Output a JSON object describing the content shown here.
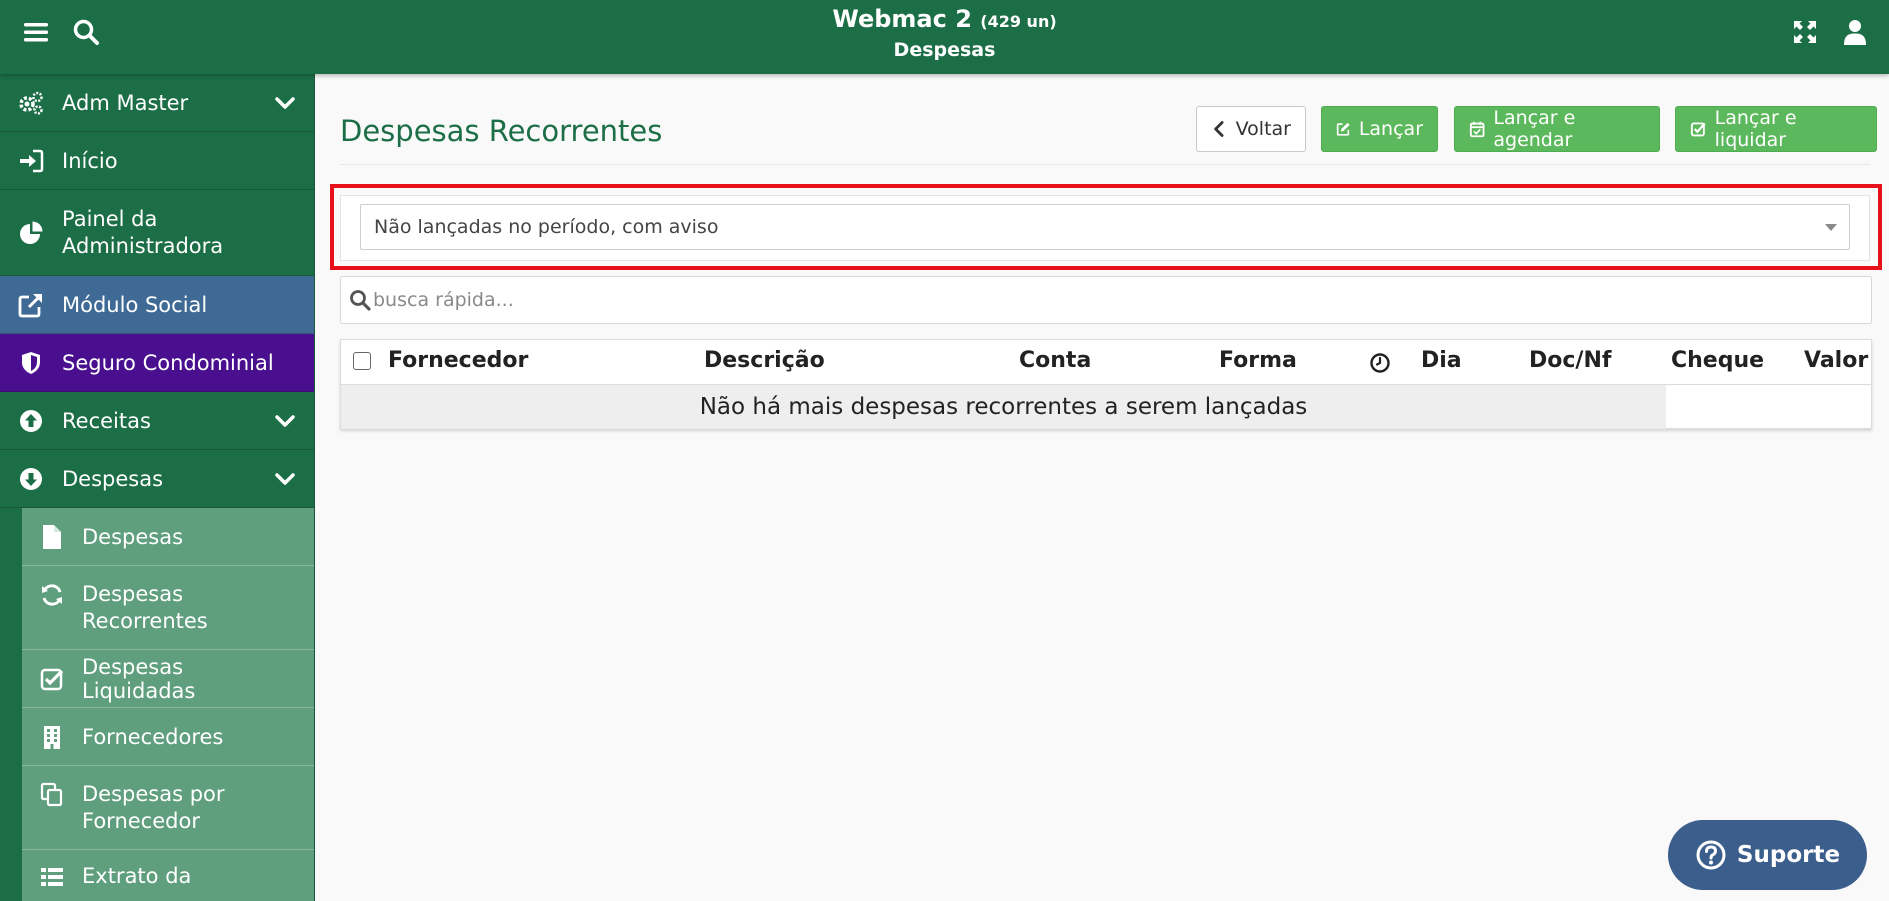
{
  "header": {
    "app_name": "Webmac 2",
    "unit_count": "(429 un)",
    "section": "Despesas"
  },
  "sidebar": {
    "items": [
      {
        "label": "Adm Master",
        "icon": "cogs-icon",
        "has_chevron": true
      },
      {
        "label": "Início",
        "icon": "sign-in-icon"
      },
      {
        "label": "Painel da Administradora",
        "icon": "pie-chart-icon"
      },
      {
        "label": "Módulo Social",
        "icon": "external-link-icon",
        "color": "#3f6a95"
      },
      {
        "label": "Seguro Condominial",
        "icon": "shield-icon",
        "color": "#4a0f8f"
      },
      {
        "label": "Receitas",
        "icon": "arrow-circle-up-icon",
        "has_chevron": true
      },
      {
        "label": "Despesas",
        "icon": "arrow-circle-down-icon",
        "has_chevron": true
      }
    ],
    "sub_items": [
      {
        "label": "Despesas",
        "icon": "file-icon"
      },
      {
        "label": "Despesas Recorrentes",
        "icon": "refresh-icon"
      },
      {
        "label": "Despesas Liquidadas",
        "icon": "check-square-icon"
      },
      {
        "label": "Fornecedores",
        "icon": "building-icon"
      },
      {
        "label": "Despesas por Fornecedor",
        "icon": "copy-icon"
      },
      {
        "label": "Extrato da",
        "icon": "list-icon"
      }
    ]
  },
  "main": {
    "title": "Despesas Recorrentes",
    "buttons": {
      "back": "Voltar",
      "launch": "Lançar",
      "launch_schedule": "Lançar e agendar",
      "launch_settle": "Lançar e liquidar"
    },
    "filter": {
      "selected": "Não lançadas no período, com aviso"
    },
    "search": {
      "placeholder": "busca rápida..."
    },
    "table": {
      "columns": [
        "Fornecedor",
        "Descrição",
        "Conta",
        "Forma",
        "Dia",
        "Doc/Nf",
        "Cheque",
        "Valor"
      ],
      "empty_message": "Não há mais despesas recorrentes a serem lançadas"
    }
  },
  "support": {
    "label": "Suporte"
  },
  "colors": {
    "header_green": "#1c6e47",
    "sub_menu_green": "#5f9f7e",
    "success_button": "#5cb85c",
    "highlight_red": "#e8101a",
    "support_blue": "#3b5e8c"
  }
}
